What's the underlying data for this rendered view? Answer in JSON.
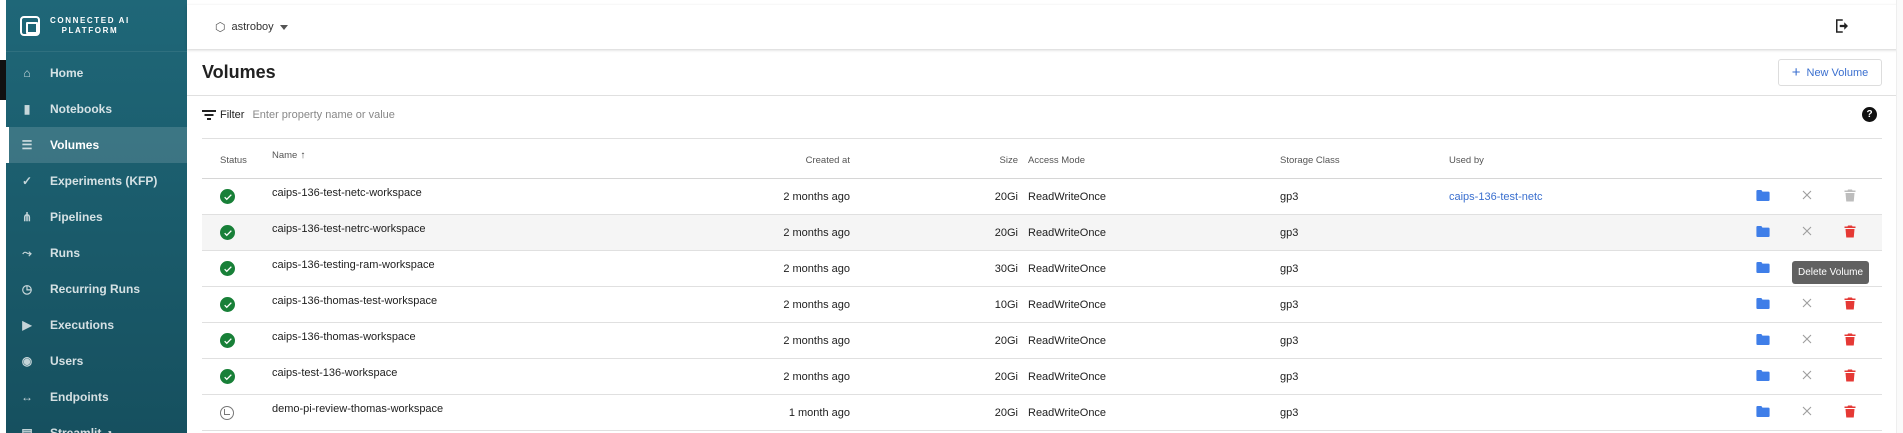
{
  "brand": {
    "line1": "CONNECTED AI",
    "line2": "PLATFORM"
  },
  "nav": [
    {
      "label": "Home",
      "icon": "home-icon"
    },
    {
      "label": "Notebooks",
      "icon": "notebook-icon"
    },
    {
      "label": "Volumes",
      "icon": "list-icon",
      "active": true
    },
    {
      "label": "Experiments (KFP)",
      "icon": "checks-icon"
    },
    {
      "label": "Pipelines",
      "icon": "pipeline-icon"
    },
    {
      "label": "Runs",
      "icon": "run-icon"
    },
    {
      "label": "Recurring Runs",
      "icon": "alarm-icon"
    },
    {
      "label": "Executions",
      "icon": "play-icon"
    },
    {
      "label": "Users",
      "icon": "users-icon"
    },
    {
      "label": "Endpoints",
      "icon": "arrows-icon"
    },
    {
      "label": "Streamlit",
      "icon": "streamlit-icon"
    }
  ],
  "topbar": {
    "namespace": "astroboy"
  },
  "page": {
    "title": "Volumes",
    "new_button": "New Volume"
  },
  "filter": {
    "label": "Filter",
    "placeholder": "Enter property name or value"
  },
  "table": {
    "headers": {
      "status": "Status",
      "name": "Name",
      "created": "Created at",
      "size": "Size",
      "access": "Access Mode",
      "storage": "Storage Class",
      "used": "Used by"
    },
    "rows": [
      {
        "status": "ok",
        "name": "caips-136-test-netc-workspace",
        "created": "2 months ago",
        "size": "20Gi",
        "access": "ReadWriteOnce",
        "storage": "gp3",
        "used": "caips-136-test-netc",
        "delete_enabled": false
      },
      {
        "status": "ok",
        "name": "caips-136-test-netrc-workspace",
        "created": "2 months ago",
        "size": "20Gi",
        "access": "ReadWriteOnce",
        "storage": "gp3",
        "used": "",
        "delete_enabled": true
      },
      {
        "status": "ok",
        "name": "caips-136-testing-ram-workspace",
        "created": "2 months ago",
        "size": "30Gi",
        "access": "ReadWriteOnce",
        "storage": "gp3",
        "used": "",
        "delete_enabled": true
      },
      {
        "status": "ok",
        "name": "caips-136-thomas-test-workspace",
        "created": "2 months ago",
        "size": "10Gi",
        "access": "ReadWriteOnce",
        "storage": "gp3",
        "used": "",
        "delete_enabled": true
      },
      {
        "status": "ok",
        "name": "caips-136-thomas-workspace",
        "created": "2 months ago",
        "size": "20Gi",
        "access": "ReadWriteOnce",
        "storage": "gp3",
        "used": "",
        "delete_enabled": true
      },
      {
        "status": "ok",
        "name": "caips-test-136-workspace",
        "created": "2 months ago",
        "size": "20Gi",
        "access": "ReadWriteOnce",
        "storage": "gp3",
        "used": "",
        "delete_enabled": true
      },
      {
        "status": "pending",
        "name": "demo-pi-review-thomas-workspace",
        "created": "1 month ago",
        "size": "20Gi",
        "access": "ReadWriteOnce",
        "storage": "gp3",
        "used": "",
        "delete_enabled": true
      }
    ]
  },
  "tooltip": "Delete Volume",
  "colors": {
    "sidebar": "#1f6778",
    "accent": "#3a6fcf",
    "ok": "#188038",
    "danger": "#e53935",
    "folder": "#3f7ee8"
  }
}
